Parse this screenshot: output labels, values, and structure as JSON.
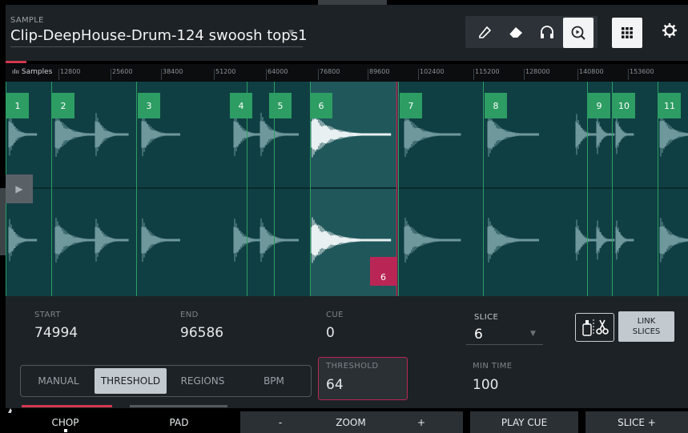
{
  "header": {
    "label": "SAMPLE",
    "sample_name": "Clip-DeepHouse-Drum-124 swoosh tops1"
  },
  "toolbar": [
    {
      "name": "pencil-icon",
      "glyph": "✎",
      "active": false
    },
    {
      "name": "eraser-icon",
      "glyph": "⌫",
      "active": false
    },
    {
      "name": "headphones-icon",
      "glyph": "Ω",
      "active": false
    },
    {
      "name": "zoom-play-icon",
      "glyph": "⊕",
      "active": true
    }
  ],
  "ruler": {
    "label": "Samples",
    "ticks": [
      "12800",
      "25600",
      "38400",
      "51200",
      "64000",
      "76800",
      "89600",
      "102400",
      "115200",
      "128000",
      "140800",
      "153600"
    ]
  },
  "slices": [
    "1",
    "2",
    "3",
    "4",
    "5",
    "6",
    "7",
    "8",
    "9",
    "10",
    "11"
  ],
  "selected_slice_end_label": "6",
  "params": {
    "start": {
      "label": "START",
      "value": "74994"
    },
    "end": {
      "label": "END",
      "value": "96586"
    },
    "cue": {
      "label": "CUE",
      "value": "0"
    },
    "slice": {
      "label": "SLICE",
      "value": "6"
    },
    "link": {
      "line1": "LINK",
      "line2": "SLICES"
    },
    "threshold": {
      "label": "THRESHOLD",
      "value": "64"
    },
    "min_time": {
      "label": "MIN TIME",
      "value": "100"
    }
  },
  "modes": [
    "MANUAL",
    "THRESHOLD",
    "REGIONS",
    "BPM"
  ],
  "active_mode": "THRESHOLD",
  "bottom": {
    "chop": "CHOP",
    "pad": "PAD",
    "zoom_minus": "-",
    "zoom": "ZOOM",
    "zoom_plus": "+",
    "play_cue": "PLAY CUE",
    "slice_plus": "SLICE +"
  },
  "colors": {
    "accent_red": "#d1394f",
    "slice_green": "#2d9d63",
    "waveform_bg": "#0f3f43",
    "selected_region": "#20575b"
  }
}
